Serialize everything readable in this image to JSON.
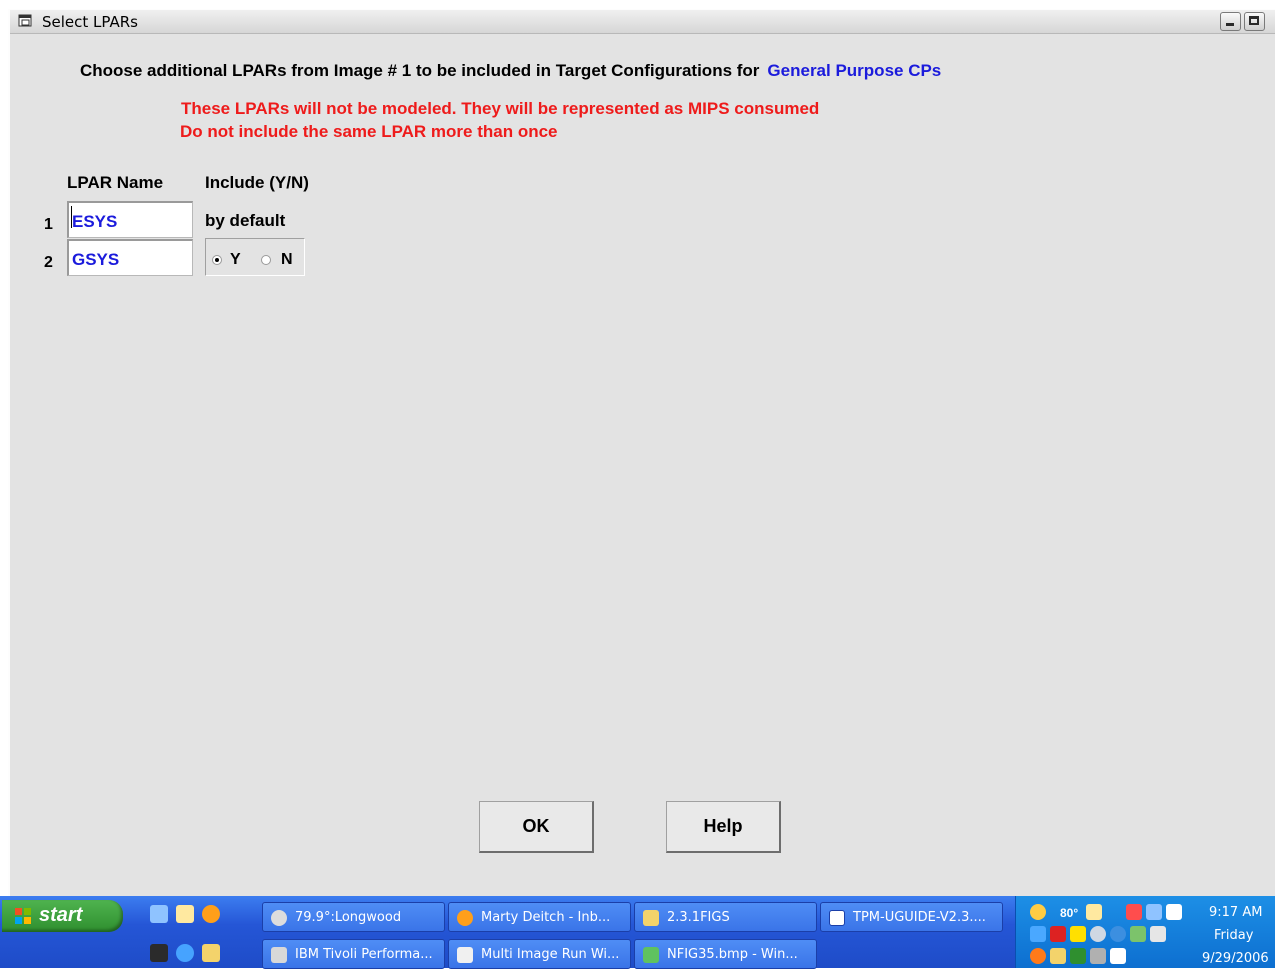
{
  "window": {
    "title": "Select LPARs",
    "heading": "Choose additional LPARs from Image # 1 to be included in Target Configurations for",
    "heading_accent": "General Purpose CPs",
    "warning_1": "These LPARs will not be modeled.  They will be represented as MIPS consumed",
    "warning_2": "Do not include the same LPAR more than once",
    "col_name": "LPAR Name",
    "col_include": "Include (Y/N)",
    "default_label": "by default",
    "rows": [
      {
        "num": "1",
        "value": "ESYS"
      },
      {
        "num": "2",
        "value": "GSYS"
      }
    ],
    "radio_y": "Y",
    "radio_n": "N",
    "selected_radio": "Y",
    "ok_label": "OK",
    "help_label": "Help",
    "accent_color": "#1b1bdc",
    "warning_color": "#ee1b1b"
  },
  "taskbar": {
    "start_label": "start",
    "tasks_row1": [
      "79.9°:Longwood",
      "Marty Deitch - Inb...",
      "2.3.1FIGS",
      "TPM-UGUIDE-V2.3...."
    ],
    "tasks_row2": [
      "IBM Tivoli Performa...",
      "Multi Image Run Wi...",
      "NFIG35.bmp - Win..."
    ],
    "tray_temp": "80°",
    "clock_time": "9:17 AM",
    "clock_day": "Friday",
    "clock_date": "9/29/2006"
  }
}
